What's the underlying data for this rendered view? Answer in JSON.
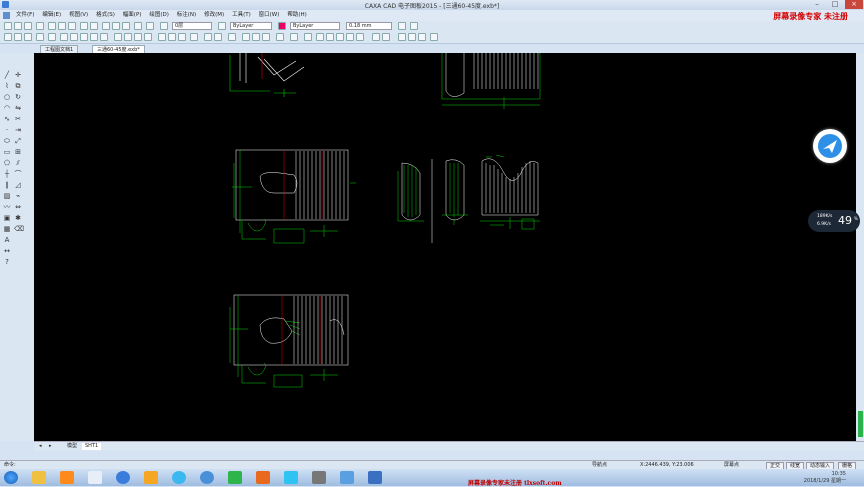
{
  "window": {
    "title": "CAXA CAD 电子图板2015 - [三通60-45度.exb*]",
    "controls": [
      "–",
      "□",
      "×"
    ]
  },
  "watermarks": {
    "top_right": "屏幕录像专家 未注册",
    "taskbar": "屏幕录像专家未注册 tlxsoft.com"
  },
  "menu": [
    "文件(F)",
    "编辑(E)",
    "视图(V)",
    "格式(S)",
    "幅面(P)",
    "绘图(D)",
    "标注(N)",
    "修改(M)",
    "工具(T)",
    "窗口(W)",
    "帮助(H)"
  ],
  "properties_bar": {
    "layer_value": "0层",
    "color_value": "ByLayer",
    "linetype_value": "ByLayer",
    "lineweight_value": "0.18 mm"
  },
  "doc_tabs": [
    "工程图文档1",
    "三通60-45度.exb*"
  ],
  "layout_tabs": [
    "模型",
    "SHT1"
  ],
  "status": {
    "left_label": "命令:",
    "mode": "导航点",
    "coords": "X:2446.439, Y:23.006",
    "snap": "屏幕点",
    "buttons": [
      "正交",
      "线宽",
      "动态输入",
      "栅格"
    ]
  },
  "clock": {
    "time": "10:35",
    "date": "2018/1/29 星期一"
  },
  "network_widget": {
    "up": "189K/s",
    "down": "6.9K/s",
    "percent": "49",
    "percent_unit": "%"
  },
  "colors": {
    "canvas": "#000000",
    "geometry": "#ffffff",
    "dimension": "#00d000",
    "centerline": "#e00000",
    "chrome": "#dbe6f3",
    "watermark": "#d30000"
  },
  "icons": {
    "top_toolbar": [
      "new-icon",
      "open-icon",
      "save-icon",
      "print-icon",
      "cut-icon",
      "copy-icon",
      "paste-icon",
      "undo-icon",
      "redo-icon",
      "zoom-icon",
      "pan-icon",
      "layer-icon",
      "color-icon"
    ],
    "left_toolbar": [
      "line-icon",
      "circle-icon",
      "arc-icon",
      "rectangle-icon",
      "polyline-icon",
      "hatch-icon",
      "text-icon",
      "dimension-icon",
      "move-icon",
      "copy-icon",
      "trim-icon",
      "mirror-icon"
    ],
    "taskbar": [
      "start-icon",
      "explorer-icon",
      "ie-icon",
      "media-icon",
      "folder-icon",
      "app-icon",
      "caxa-icon"
    ]
  }
}
